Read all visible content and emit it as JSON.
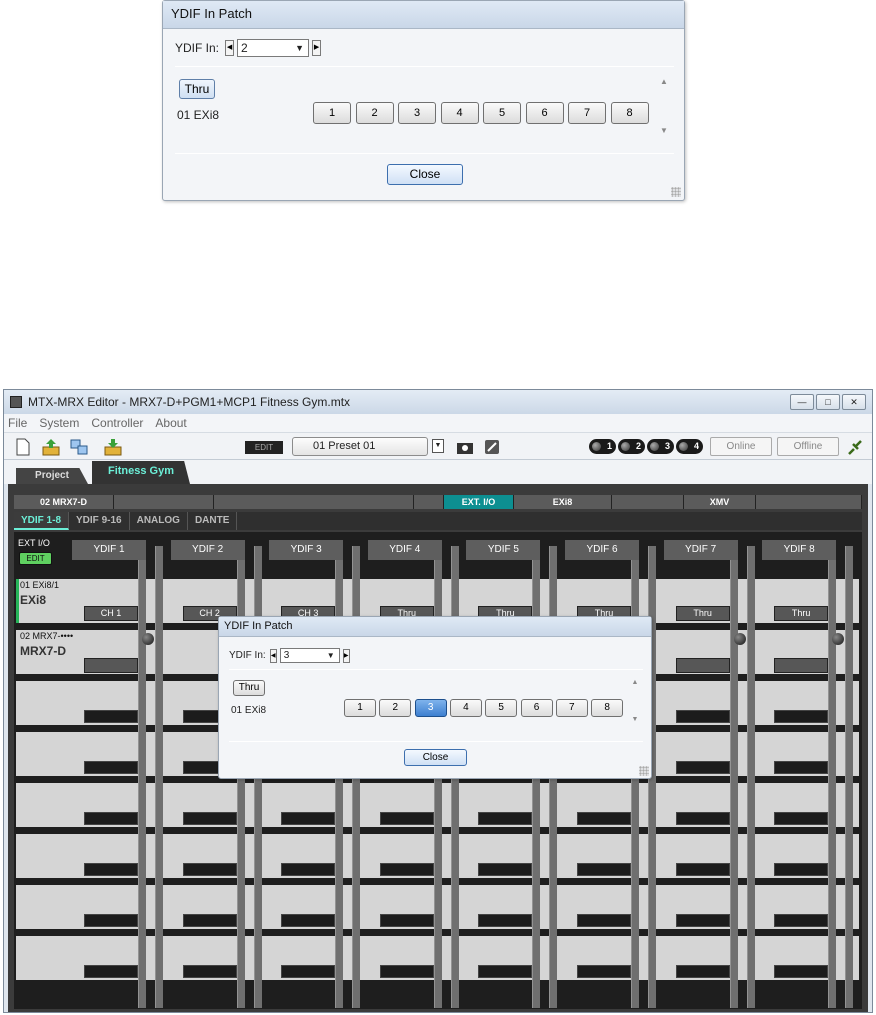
{
  "top_dialog": {
    "title": "YDIF In Patch",
    "ydif_in_label": "YDIF In:",
    "ydif_in_value": "2",
    "thru_label": "Thru",
    "device_label": "01 EXi8",
    "channels": [
      "1",
      "2",
      "3",
      "4",
      "5",
      "6",
      "7",
      "8"
    ],
    "close_label": "Close"
  },
  "window": {
    "title": "MTX-MRX Editor - MRX7-D+PGM1+MCP1 Fitness Gym.mtx",
    "menu": [
      "File",
      "System",
      "Controller",
      "About"
    ],
    "toolbar": {
      "edit_label": "EDIT",
      "preset_value": "01 Preset 01",
      "memory": [
        "1",
        "2",
        "3",
        "4"
      ],
      "online_label": "Online",
      "offline_label": "Offline"
    },
    "tabs": {
      "project": "Project",
      "system": "Fitness Gym"
    },
    "units": [
      "02 MRX7-D",
      "",
      "",
      "",
      "EXT. I/O",
      "EXi8",
      "",
      "XMV",
      ""
    ],
    "subtabs": [
      "YDIF 1-8",
      "YDIF 9-16",
      "ANALOG",
      "DANTE"
    ],
    "ext_io_label": "EXT I/O",
    "edit_btn": "EDIT",
    "ydif_labels": [
      "YDIF 1",
      "YDIF 2",
      "YDIF 3",
      "YDIF 4",
      "YDIF 5",
      "YDIF 6",
      "YDIF 7",
      "YDIF 8"
    ],
    "row1": {
      "id": "01 EXi8/1",
      "name": "EXi8",
      "buttons": [
        "CH 1",
        "CH 2",
        "CH 3",
        "Thru",
        "Thru",
        "Thru",
        "Thru",
        "Thru"
      ]
    },
    "row2": {
      "id": "02 MRX7-••••",
      "name": "MRX7-D"
    }
  },
  "inner_dialog": {
    "title": "YDIF In Patch",
    "ydif_in_label": "YDIF In:",
    "ydif_in_value": "3",
    "thru_label": "Thru",
    "device_label": "01 EXi8",
    "channels": [
      "1",
      "2",
      "3",
      "4",
      "5",
      "6",
      "7",
      "8"
    ],
    "selected_channel": "3",
    "close_label": "Close"
  },
  "colors": {
    "accent_teal": "#0d8f91",
    "tab_text": "#6cf0d8",
    "edit_green": "#5fd060",
    "selected_blue": "#3d7fd0"
  }
}
